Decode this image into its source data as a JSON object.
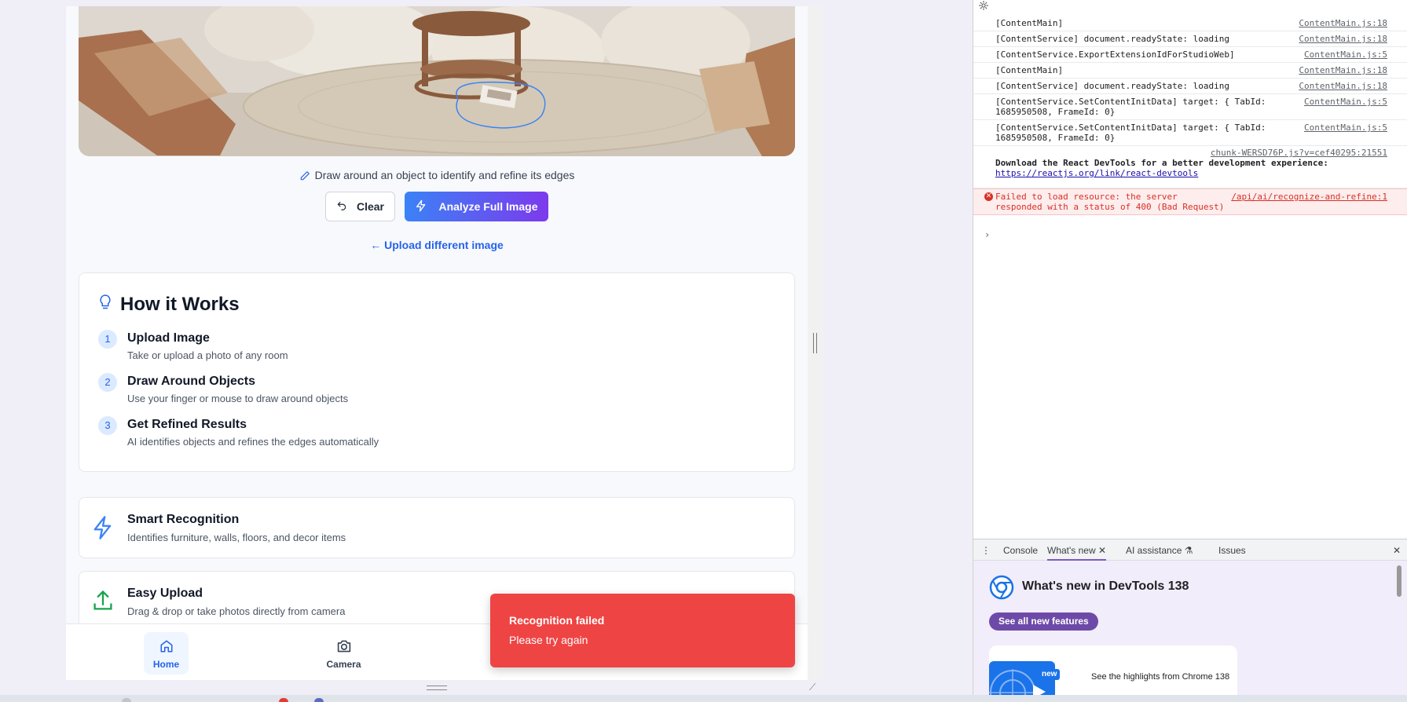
{
  "app": {
    "hint_text": "Draw around an object to identify and refine its edges",
    "clear_label": "Clear",
    "analyze_label": "Analyze Full Image",
    "upload_link": "← Upload different image",
    "how_title": "How it Works",
    "steps": [
      {
        "num": "1",
        "title": "Upload Image",
        "desc": "Take or upload a photo of any room"
      },
      {
        "num": "2",
        "title": "Draw Around Objects",
        "desc": "Use your finger or mouse to draw around objects"
      },
      {
        "num": "3",
        "title": "Get Refined Results",
        "desc": "AI identifies objects and refines the edges automatically"
      }
    ],
    "features": [
      {
        "title": "Smart Recognition",
        "desc": "Identifies furniture, walls, floors, and decor items"
      },
      {
        "title": "Easy Upload",
        "desc": "Drag & drop or take photos directly from camera"
      }
    ],
    "nav": {
      "home": "Home",
      "camera": "Camera"
    },
    "toast": {
      "title": "Recognition failed",
      "message": "Please try again"
    },
    "colors": {
      "accent": "#3b82f6",
      "accent2": "#7c3aed",
      "error": "#ef4444",
      "link": "#2563eb"
    }
  },
  "devtools": {
    "logs": [
      {
        "msg": "[ContentMain]",
        "src": "ContentMain.js:18"
      },
      {
        "msg": "[ContentService] document.readyState: loading",
        "src": "ContentMain.js:18"
      },
      {
        "msg": "[ContentService.ExportExtensionIdForStudioWeb]",
        "src": "ContentMain.js:5"
      },
      {
        "msg": "[ContentMain]",
        "src": "ContentMain.js:18"
      },
      {
        "msg": "[ContentService] document.readyState: loading",
        "src": "ContentMain.js:18"
      },
      {
        "msg": "[ContentService.SetContentInitData] target: { TabId:\n1685950508, FrameId: 0}",
        "src": "ContentMain.js:5"
      },
      {
        "msg": "[ContentService.SetContentInitData] target: { TabId:\n1685950508, FrameId: 0}",
        "src": "ContentMain.js:5"
      }
    ],
    "react_src": "chunk-WERSD76P.js?v=cef40295:21551",
    "react_msg": "Download the React DevTools for a better development experience:",
    "react_link": "https://reactjs.org/link/react-devtools",
    "error": {
      "msg": "Failed to load resource: the server\nresponded with a status of 400 (Bad Request)",
      "src": "/api/ai/recognize-and-refine:1"
    },
    "tabs": {
      "console": "Console",
      "whats_new": "What's new",
      "ai": "AI assistance",
      "issues": "Issues"
    },
    "drawer_title": "What's new in DevTools 138",
    "see_all": "See all new features",
    "new_badge": "new",
    "highlight": "See the highlights from Chrome 138"
  }
}
